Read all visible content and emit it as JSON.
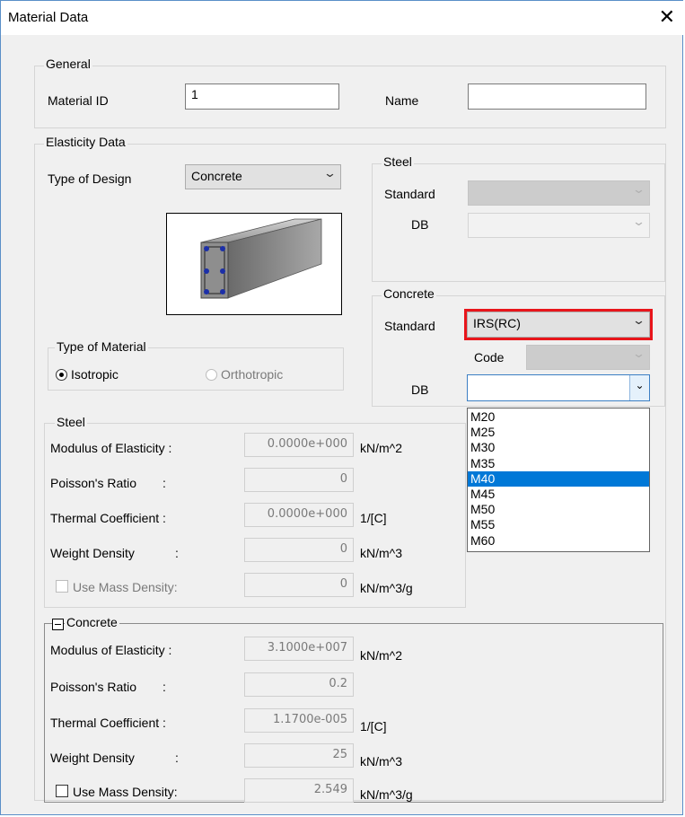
{
  "window": {
    "title": "Material Data",
    "close_glyph": "✕"
  },
  "general": {
    "label": "General",
    "material_id_label": "Material ID",
    "material_id_value": "1",
    "name_label": "Name",
    "name_value": ""
  },
  "elasticity": {
    "label": "Elasticity Data",
    "type_of_design_label": "Type of Design",
    "type_of_design_value": "Concrete",
    "type_of_material_label": "Type of Material",
    "isotropic_label": "Isotropic",
    "orthotropic_label": "Orthotropic",
    "isotropic_selected": true
  },
  "steel_std": {
    "label": "Steel",
    "standard_label": "Standard",
    "standard_value": "",
    "db_label": "DB",
    "db_value": ""
  },
  "concrete_std": {
    "label": "Concrete",
    "standard_label": "Standard",
    "standard_value": "IRS(RC)",
    "code_label": "Code",
    "code_value": "",
    "db_label": "DB",
    "db_value": "",
    "db_options": [
      "M20",
      "M25",
      "M30",
      "M35",
      "M40",
      "M45",
      "M50",
      "M55",
      "M60"
    ],
    "db_highlighted": "M40"
  },
  "steel_props": {
    "label": "Steel",
    "modulus_label": "Modulus of Elasticity :",
    "modulus_value": "0.0000e+000",
    "modulus_unit": "kN/m^2",
    "poisson_label": "Poisson's Ratio",
    "poisson_colon": ":",
    "poisson_value": "0",
    "thermal_label": "Thermal Coefficient  :",
    "thermal_value": "0.0000e+000",
    "thermal_unit": "1/[C]",
    "weight_label": "Weight Density",
    "weight_colon": ":",
    "weight_value": "0",
    "weight_unit": "kN/m^3",
    "mass_label": "Use Mass Density:",
    "mass_value": "0",
    "mass_unit": "kN/m^3/g"
  },
  "concrete_props": {
    "label": "Concrete",
    "modulus_label": "Modulus of Elasticity :",
    "modulus_value": "3.1000e+007",
    "modulus_unit": "kN/m^2",
    "poisson_label": "Poisson's Ratio",
    "poisson_colon": ":",
    "poisson_value": "0.2",
    "thermal_label": "Thermal Coefficient  :",
    "thermal_value": "1.1700e-005",
    "thermal_unit": "1/[C]",
    "weight_label": "Weight Density",
    "weight_colon": ":",
    "weight_value": "25",
    "weight_unit": "kN/m^3",
    "mass_label": "Use Mass Density:",
    "mass_value": "2.549",
    "mass_unit": "kN/m^3/g"
  },
  "colors": {
    "highlight_border": "#e8151b",
    "selection": "#0078d7",
    "window_border": "#5a8fc8"
  },
  "icons": {
    "close": "close-icon",
    "dropdown": "chevron-down-icon",
    "preview": "concrete-beam-section-image"
  }
}
